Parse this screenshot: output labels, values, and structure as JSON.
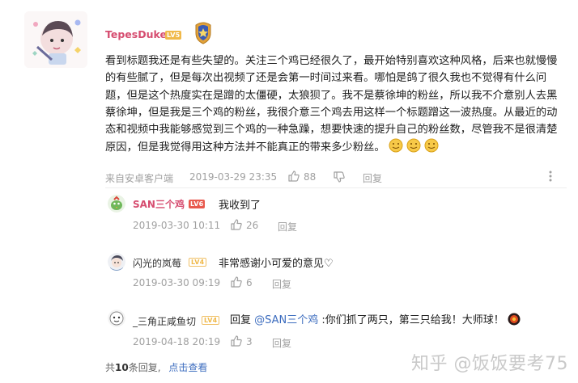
{
  "main_comment": {
    "username": "TepesDuke",
    "level_badge": "LV5",
    "text": "看到标题我还是有些失望的。关注三个鸡已经很久了，最开始特别喜欢这种风格，后来也就慢慢的有些腻了，但是每次出视频了还是会第一时间过来看。哪怕是鸽了很久我也不觉得有什么问题，但是这个热度实在是蹭的太僵硬，太狼狈了。我不是蔡徐坤的粉丝，所以我不介意别人去黑蔡徐坤，但是我是三个鸡的粉丝，我很介意三个鸡去用这样一个标题蹭这一波热度。从最近的动态和视频中我能够感觉到三个鸡的一种急躁，想要快速的提升自己的粉丝数，尽管我不是很清楚原因，但是我觉得用这种方法并不能真正的带来多少粉丝。",
    "emoji_count": 3,
    "source": "来自安卓客户端",
    "timestamp": "2019-03-29 23:35",
    "likes": "88",
    "reply_label": "回复",
    "more_icon": "more-vertical-icon"
  },
  "replies": [
    {
      "username": "SAN三个鸡",
      "level_badge": "LV6",
      "text": "我收到了",
      "timestamp": "2019-03-30 10:11",
      "likes": "26",
      "reply_label": "回复"
    },
    {
      "username": "闪光的岚莓",
      "level_badge": "LV4",
      "text": "非常感谢小可爱的意见♡",
      "timestamp": "2019-03-30 09:19",
      "likes": "6",
      "reply_label": "回复"
    },
    {
      "username": "_三角正咸鱼切",
      "level_badge": "LV4",
      "text_prefix": "回复 ",
      "mention": "@SAN三个鸡",
      "text_suffix": " :你们抓了两只，第三只给我！大师球！",
      "timestamp": "2019-04-18 20:19",
      "likes": "3",
      "reply_label": "回复"
    }
  ],
  "footer": {
    "summary_prefix": "共",
    "reply_count": "10",
    "summary_suffix": "条回复,",
    "expand_link": "点击查看"
  },
  "watermark": "知乎 @饭饭要考75",
  "colors": {
    "username_pink": "#d64d70",
    "link_blue": "#3d6dbf",
    "meta_gray": "#a0a0a0"
  }
}
